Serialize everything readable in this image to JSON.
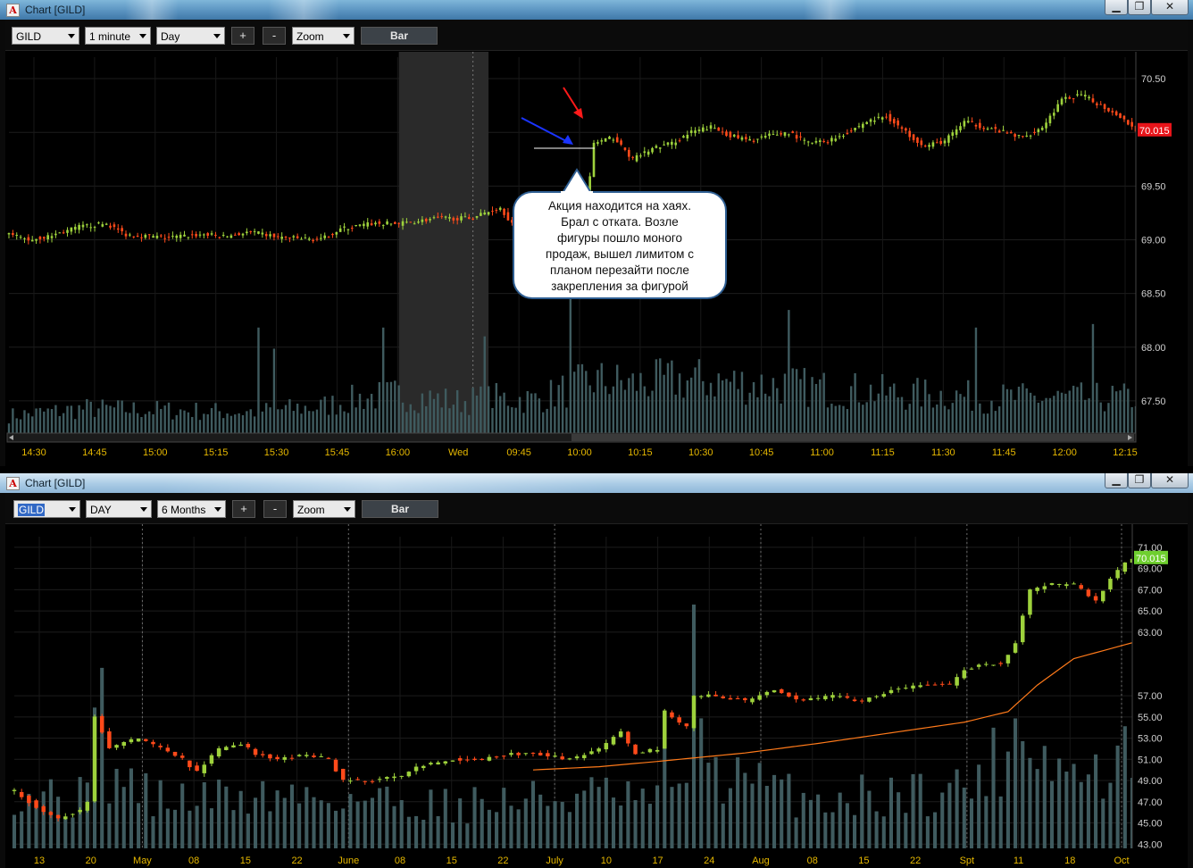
{
  "top_window": {
    "title": "Chart [GILD]",
    "symbol": "GILD",
    "interval": "1 minute",
    "period": "Day",
    "plus": "+",
    "minus": "-",
    "zoom": "Zoom",
    "chart_style": "Bar",
    "last_price": "70.015",
    "minimize": "▁",
    "restore": "❐",
    "close": "✕"
  },
  "bottom_window": {
    "title": "Chart [GILD]",
    "symbol": "GILD",
    "interval": "DAY",
    "period": "6 Months",
    "plus": "+",
    "minus": "-",
    "zoom": "Zoom",
    "chart_style": "Bar",
    "last_price": "70.015",
    "minimize": "▁",
    "restore": "❐",
    "close": "✕"
  },
  "annotation": {
    "lines": [
      "Акция находится на хаях.",
      "Брал с отката. Возле",
      "фигуры пошло моного",
      "продаж, вышел лимитом с",
      "планом перезайти после",
      "закрепления за фигурой"
    ]
  },
  "colors": {
    "up": "#9ed23c",
    "down": "#ff4a1a",
    "volume": "#3f5b5f",
    "ma": "#ff7a1a",
    "price_tag_top": "#e8141a",
    "price_tag_bottom": "#6fcf2f",
    "axis_text": "#e6b800",
    "arrow_blue": "#1a34ff",
    "arrow_red": "#ff1a1a"
  },
  "chart_data": [
    {
      "type": "candlestick",
      "name": "intraday",
      "ylim": [
        67.2,
        70.65
      ],
      "y_ticks": [
        "70.50",
        "70.00",
        "69.50",
        "69.00",
        "68.50",
        "68.00",
        "67.50"
      ],
      "x_ticks": [
        "14:30",
        "14:45",
        "15:00",
        "15:15",
        "15:30",
        "15:45",
        "16:00",
        "Wed",
        "09:45",
        "10:00",
        "10:15",
        "10:30",
        "10:45",
        "11:00",
        "11:15",
        "11:30",
        "11:45",
        "12:00",
        "12:15"
      ],
      "price_path": [
        [
          0,
          69.05
        ],
        [
          5,
          69.0
        ],
        [
          10,
          69.03
        ],
        [
          18,
          69.12
        ],
        [
          25,
          69.15
        ],
        [
          30,
          69.05
        ],
        [
          40,
          69.02
        ],
        [
          50,
          69.05
        ],
        [
          55,
          69.03
        ],
        [
          62,
          69.07
        ],
        [
          70,
          69.02
        ],
        [
          80,
          69.0
        ],
        [
          85,
          69.1
        ],
        [
          93,
          69.15
        ],
        [
          100,
          69.15
        ],
        [
          110,
          69.2
        ],
        [
          118,
          69.2
        ],
        [
          126,
          69.3
        ],
        [
          132,
          69.0
        ],
        [
          138,
          69.1
        ],
        [
          145,
          69.2
        ],
        [
          148,
          69.25
        ],
        [
          150,
          69.9
        ],
        [
          155,
          69.95
        ],
        [
          160,
          69.75
        ],
        [
          165,
          69.85
        ],
        [
          170,
          69.9
        ],
        [
          175,
          70.0
        ],
        [
          180,
          70.05
        ],
        [
          185,
          69.97
        ],
        [
          190,
          69.92
        ],
        [
          195,
          69.97
        ],
        [
          200,
          70.0
        ],
        [
          205,
          69.9
        ],
        [
          210,
          69.92
        ],
        [
          215,
          70.0
        ],
        [
          220,
          70.1
        ],
        [
          225,
          70.15
        ],
        [
          230,
          70.0
        ],
        [
          235,
          69.87
        ],
        [
          240,
          69.92
        ],
        [
          245,
          70.1
        ],
        [
          250,
          70.05
        ],
        [
          255,
          70.0
        ],
        [
          260,
          69.95
        ],
        [
          265,
          70.05
        ],
        [
          270,
          70.3
        ],
        [
          275,
          70.35
        ],
        [
          280,
          70.25
        ],
        [
          285,
          70.15
        ],
        [
          289,
          70.02
        ]
      ],
      "volume_path": [
        [
          0,
          0.1
        ],
        [
          20,
          0.14
        ],
        [
          40,
          0.13
        ],
        [
          60,
          0.12
        ],
        [
          80,
          0.15
        ],
        [
          90,
          0.2
        ],
        [
          100,
          0.22
        ],
        [
          115,
          0.18
        ],
        [
          125,
          0.2
        ],
        [
          135,
          0.19
        ],
        [
          150,
          0.3
        ],
        [
          160,
          0.28
        ],
        [
          170,
          0.3
        ],
        [
          180,
          0.3
        ],
        [
          190,
          0.28
        ],
        [
          200,
          0.27
        ],
        [
          210,
          0.25
        ],
        [
          220,
          0.24
        ],
        [
          230,
          0.22
        ],
        [
          240,
          0.22
        ],
        [
          250,
          0.2
        ],
        [
          260,
          0.2
        ],
        [
          270,
          0.2
        ],
        [
          280,
          0.2
        ],
        [
          289,
          0.2
        ]
      ],
      "volume_spikes": [
        [
          64,
          0.6
        ],
        [
          68,
          0.48
        ],
        [
          96,
          0.6
        ],
        [
          122,
          0.55
        ],
        [
          144,
          0.82
        ],
        [
          200,
          0.7
        ],
        [
          248,
          0.6
        ],
        [
          278,
          0.62
        ]
      ],
      "afterhours_span": [
        100,
        123
      ],
      "session_divider": 119
    },
    {
      "type": "candlestick",
      "name": "daily",
      "ylim": [
        42.6,
        71.5
      ],
      "y_ticks": [
        "71.00",
        "69.00",
        "67.00",
        "65.00",
        "63.00",
        "57.00",
        "55.00",
        "53.00",
        "51.00",
        "49.00",
        "47.00",
        "45.00",
        "43.00"
      ],
      "x_ticks": [
        "13",
        "20",
        "May",
        "08",
        "15",
        "22",
        "June",
        "08",
        "15",
        "22",
        "July",
        "10",
        "17",
        "24",
        "Aug",
        "08",
        "15",
        "22",
        "Spt",
        "11",
        "18",
        "Oct"
      ],
      "month_dividers": [
        "May",
        "June",
        "July",
        "Aug",
        "Spt",
        "Oct"
      ],
      "price_path": [
        [
          0,
          48.0
        ],
        [
          3,
          46.5
        ],
        [
          6,
          45.5
        ],
        [
          9,
          46.2
        ],
        [
          10,
          47.0
        ],
        [
          11,
          55.0
        ],
        [
          13,
          52.0
        ],
        [
          17,
          53.0
        ],
        [
          20,
          52.0
        ],
        [
          23,
          51.0
        ],
        [
          25,
          49.8
        ],
        [
          28,
          52.0
        ],
        [
          31,
          52.5
        ],
        [
          33,
          51.5
        ],
        [
          36,
          51.0
        ],
        [
          40,
          51.5
        ],
        [
          43,
          51.0
        ],
        [
          45,
          49.0
        ],
        [
          49,
          49.0
        ],
        [
          53,
          49.5
        ],
        [
          56,
          50.5
        ],
        [
          60,
          51.0
        ],
        [
          64,
          51.0
        ],
        [
          68,
          51.5
        ],
        [
          72,
          51.5
        ],
        [
          76,
          51.0
        ],
        [
          80,
          52.0
        ],
        [
          83,
          53.5
        ],
        [
          85,
          51.5
        ],
        [
          88,
          52.0
        ],
        [
          89,
          55.5
        ],
        [
          92,
          54.0
        ],
        [
          93,
          57.0
        ],
        [
          96,
          57.0
        ],
        [
          100,
          56.5
        ],
        [
          104,
          57.5
        ],
        [
          108,
          56.5
        ],
        [
          112,
          57.0
        ],
        [
          116,
          56.5
        ],
        [
          120,
          57.5
        ],
        [
          124,
          58.0
        ],
        [
          128,
          58.0
        ],
        [
          130,
          59.5
        ],
        [
          133,
          60.0
        ],
        [
          135,
          60.0
        ],
        [
          137,
          62.0
        ],
        [
          139,
          67.0
        ],
        [
          142,
          67.5
        ],
        [
          145,
          67.5
        ],
        [
          148,
          66.0
        ],
        [
          150,
          68.0
        ],
        [
          152,
          69.5
        ],
        [
          153,
          70.0
        ]
      ],
      "volume_path": [
        [
          0,
          0.25
        ],
        [
          10,
          0.2
        ],
        [
          11,
          0.9
        ],
        [
          13,
          0.3
        ],
        [
          20,
          0.2
        ],
        [
          40,
          0.22
        ],
        [
          60,
          0.18
        ],
        [
          80,
          0.22
        ],
        [
          88,
          0.18
        ],
        [
          89,
          0.4
        ],
        [
          92,
          0.2
        ],
        [
          93,
          0.8
        ],
        [
          96,
          0.3
        ],
        [
          110,
          0.2
        ],
        [
          130,
          0.25
        ],
        [
          136,
          0.4
        ],
        [
          138,
          0.6
        ],
        [
          140,
          0.4
        ],
        [
          145,
          0.3
        ],
        [
          150,
          0.3
        ],
        [
          153,
          0.4
        ]
      ],
      "ma_path": [
        [
          71,
          50.0
        ],
        [
          80,
          50.3
        ],
        [
          88,
          50.8
        ],
        [
          100,
          51.6
        ],
        [
          110,
          52.5
        ],
        [
          120,
          53.5
        ],
        [
          130,
          54.5
        ],
        [
          136,
          55.5
        ],
        [
          140,
          58.0
        ],
        [
          145,
          60.5
        ],
        [
          153,
          62.0
        ]
      ]
    }
  ]
}
